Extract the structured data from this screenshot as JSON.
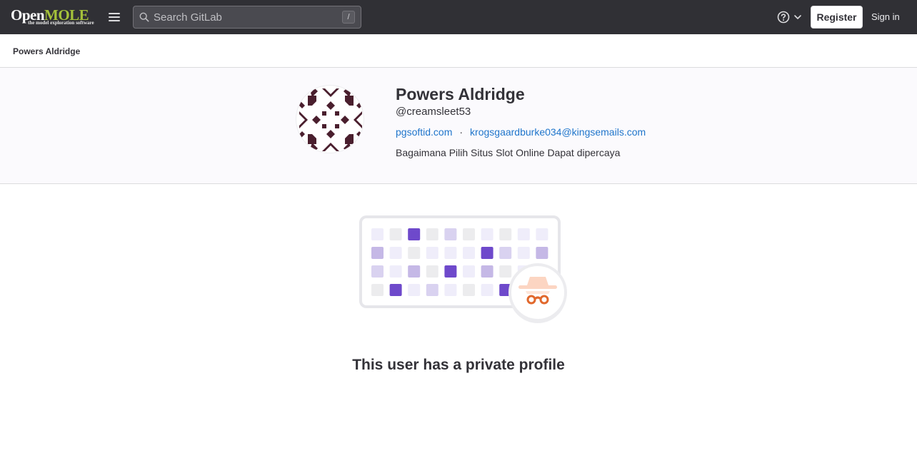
{
  "navbar": {
    "logo_main_open": "Open",
    "logo_main_mole": "MOLE",
    "logo_tagline": "the model exploration software",
    "search_placeholder": "Search GitLab",
    "search_shortcut": "/",
    "register_label": "Register",
    "signin_label": "Sign in"
  },
  "breadcrumb": {
    "current": "Powers Aldridge"
  },
  "profile": {
    "name": "Powers Aldridge",
    "username": "@creamsleet53",
    "website": "pgsoftid.com",
    "separator": "·",
    "email": "krogsgaardburke034@kingsemails.com",
    "bio": "Bagaimana Pilih Situs Slot Online Dapat dipercaya"
  },
  "empty_state": {
    "title": "This user has a private profile"
  },
  "colors": {
    "navbar_bg": "#303035",
    "link": "#1f75cb",
    "avatar": "#4a1f2e",
    "accent_purple": "#6e49cb",
    "incognito_orange": "#e1682c"
  }
}
